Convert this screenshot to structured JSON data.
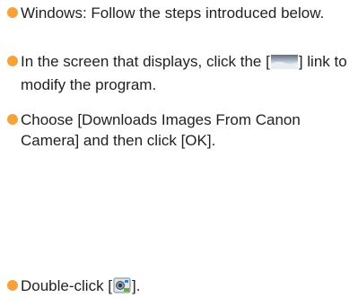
{
  "colors": {
    "bullet": "#f3a33a",
    "text": "#231f20"
  },
  "items": [
    {
      "text": "Windows: Follow the steps introduced below."
    },
    {
      "text_before": "In the screen that displays, click the [",
      "icon": "program-link-icon",
      "text_after": "] link to modify the program."
    },
    {
      "text": "Choose [Downloads Images From Canon Camera] and then click [OK]."
    },
    {
      "text_before": "Double-click [",
      "icon": "camera-app-icon",
      "text_after": "]."
    }
  ]
}
